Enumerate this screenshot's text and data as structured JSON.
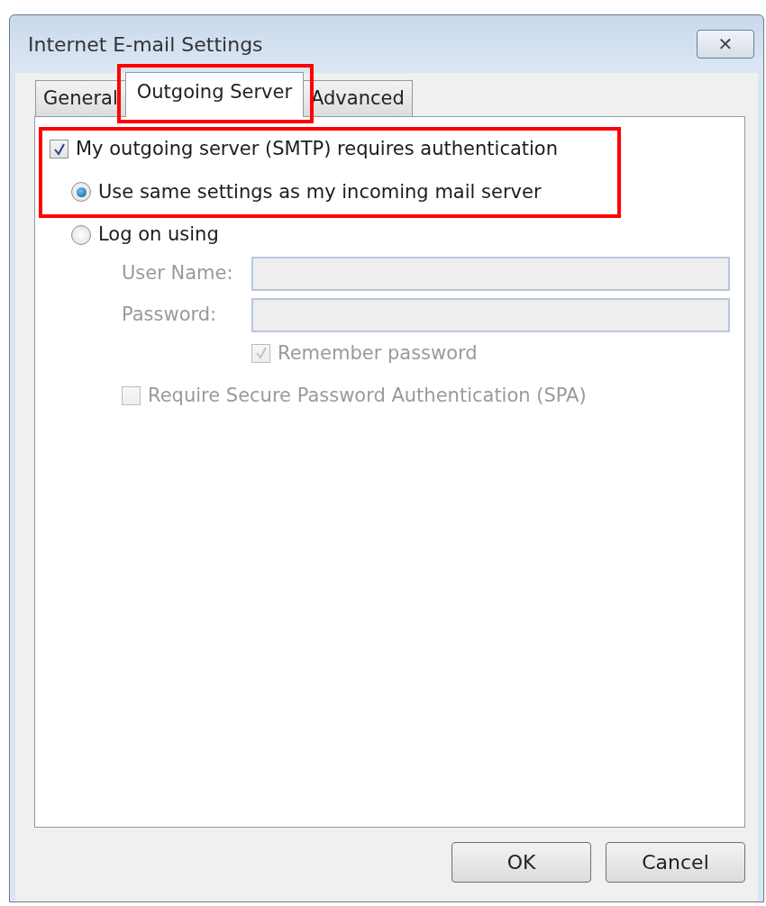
{
  "window": {
    "title": "Internet E-mail Settings",
    "close_label": "✕"
  },
  "tabs": [
    {
      "label": "General",
      "selected": false,
      "highlighted": false
    },
    {
      "label": "Outgoing Server",
      "selected": true,
      "highlighted": true
    },
    {
      "label": "Advanced",
      "selected": false,
      "highlighted": false
    }
  ],
  "auth": {
    "label": "My outgoing server (SMTP) requires authentication",
    "checked": true,
    "highlighted": true,
    "options": [
      {
        "label": "Use same settings as my incoming mail server",
        "selected": true
      },
      {
        "label": "Log on using",
        "selected": false
      }
    ]
  },
  "fields": [
    {
      "label": "User Name:",
      "disabled": true
    },
    {
      "label": "Password:",
      "disabled": true
    }
  ],
  "remember": {
    "label": "Remember password",
    "checked": true,
    "disabled": true
  },
  "spa": {
    "label": "Require Secure Password Authentication (SPA)",
    "checked": false,
    "disabled": true
  },
  "buttons": [
    "OK",
    "Cancel"
  ]
}
